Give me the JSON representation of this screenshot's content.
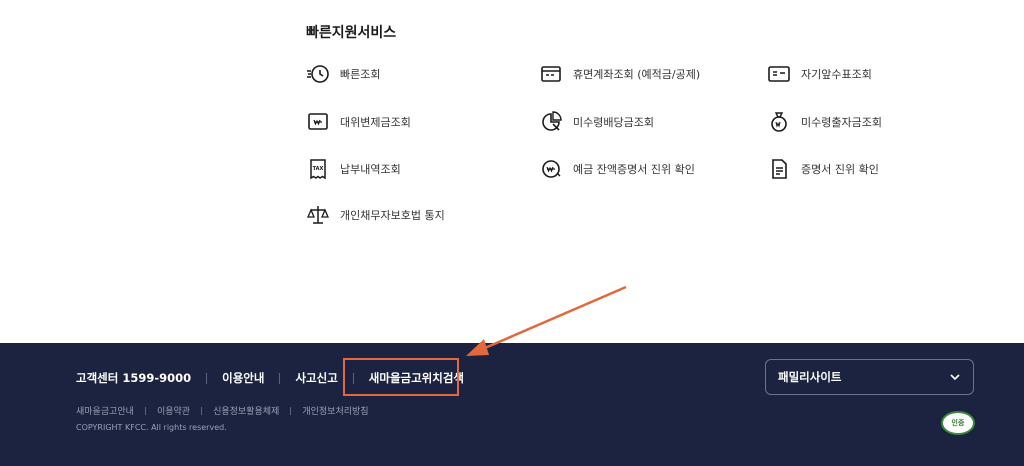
{
  "quick": {
    "title": "빠른지원서비스",
    "items": [
      {
        "label": "빠른조회",
        "icon": "fast-clock-icon"
      },
      {
        "label": "휴면계좌조회 (예적금/공제)",
        "icon": "dormant-card-icon"
      },
      {
        "label": "자기앞수표조회",
        "icon": "cheque-icon"
      },
      {
        "label": "대위변제금조회",
        "icon": "won-document-icon"
      },
      {
        "label": "미수령배당금조회",
        "icon": "dividend-icon"
      },
      {
        "label": "미수령출자금조회",
        "icon": "money-bag-icon"
      },
      {
        "label": "납부내역조회",
        "icon": "tax-receipt-icon"
      },
      {
        "label": "예금 잔액증명서 진위 확인",
        "icon": "won-coin-icon"
      },
      {
        "label": "증명서 진위 확인",
        "icon": "certificate-icon"
      },
      {
        "label": "개인채무자보호법 통지",
        "icon": "scale-icon"
      }
    ]
  },
  "footer": {
    "links": [
      {
        "label": "고객센터 1599-9000"
      },
      {
        "label": "이용안내"
      },
      {
        "label": "사고신고"
      },
      {
        "label": "새마을금고위치검색"
      }
    ],
    "sub_links": [
      {
        "label": "새마을금고안내"
      },
      {
        "label": "이용약관"
      },
      {
        "label": "신용정보활용체제"
      },
      {
        "label": "개인정보처리방침"
      }
    ],
    "copyright": "COPYRIGHT KFCC. All rights reserved.",
    "family_site": "패밀리사이트",
    "badge": "인증",
    "colors": {
      "background": "#1b2340",
      "highlight": "#e0693d"
    }
  }
}
